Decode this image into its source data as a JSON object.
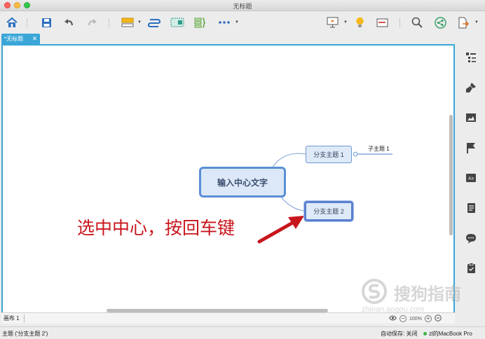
{
  "window": {
    "title": "无标题"
  },
  "tab": {
    "label": "*无标题",
    "close": "✕"
  },
  "mindmap": {
    "central": "输入中心文字",
    "branch1": "分支主题 1",
    "branch2": "分支主题 2",
    "subtopic1": "子主题 1"
  },
  "annotation": {
    "text": "选中中心，按回车键",
    "color": "#c8161d"
  },
  "sheet": {
    "label": "画布 1"
  },
  "zoom": {
    "level": "100%"
  },
  "status": {
    "selection": "主题 ('分支主题 2')",
    "autosave": "自动保存: 关闭",
    "device": "zl的MacBook Pro"
  },
  "watermark": {
    "text": "搜狗指南",
    "sub": "zhinan.sogou.com"
  },
  "colors": {
    "accent": "#3aa6d8",
    "topic_border": "#5b8fd6",
    "annotation": "#c8161d"
  },
  "icons": {
    "toolbar": [
      "home-icon",
      "save-icon",
      "undo-icon",
      "redo-icon",
      "insert-topic-icon",
      "relationship-icon",
      "boundary-icon",
      "summary-icon",
      "more-icon",
      "presentation-icon",
      "idea-icon",
      "layout-icon",
      "search-icon",
      "share-icon",
      "export-icon"
    ],
    "right_panel": [
      "outline-icon",
      "format-icon",
      "image-icon",
      "marker-icon",
      "text-icon",
      "notes-icon",
      "comment-icon",
      "task-icon"
    ]
  }
}
